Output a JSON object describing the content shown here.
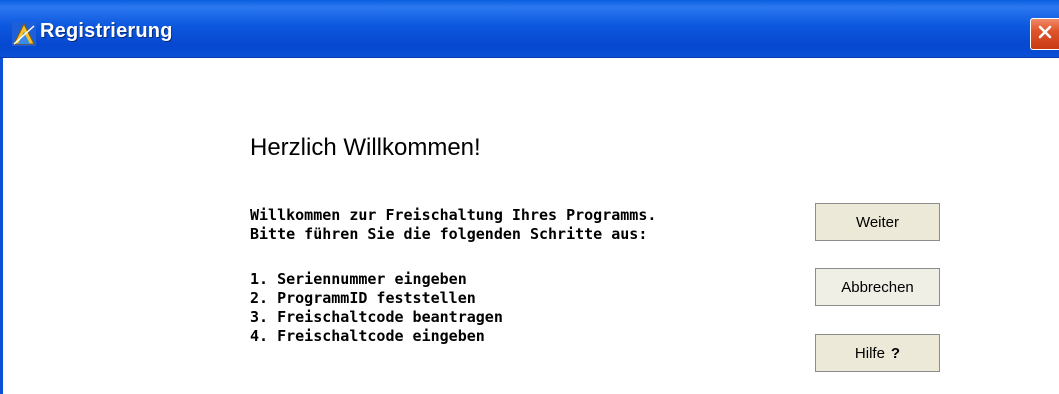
{
  "window": {
    "title": "Registrierung",
    "title_icon": "registration-app-icon",
    "close_icon": "close-x-icon"
  },
  "content": {
    "heading": "Herzlich Willkommen!",
    "intro_lines": [
      "Willkommen zur Freischaltung Ihres Programms.",
      "Bitte führen Sie die folgenden Schritte aus:"
    ],
    "steps": [
      "1. Seriennummer eingeben",
      "2. ProgrammID feststellen",
      "3. Freischaltcode beantragen",
      "4. Freischaltcode eingeben"
    ]
  },
  "buttons": {
    "next_label": "Weiter",
    "cancel_label": "Abbrechen",
    "help_label": "Hilfe",
    "help_suffix": "?"
  },
  "colors": {
    "titlebar": "#0c58df",
    "close_button": "#e0542a",
    "button_face": "#ece9d8"
  }
}
